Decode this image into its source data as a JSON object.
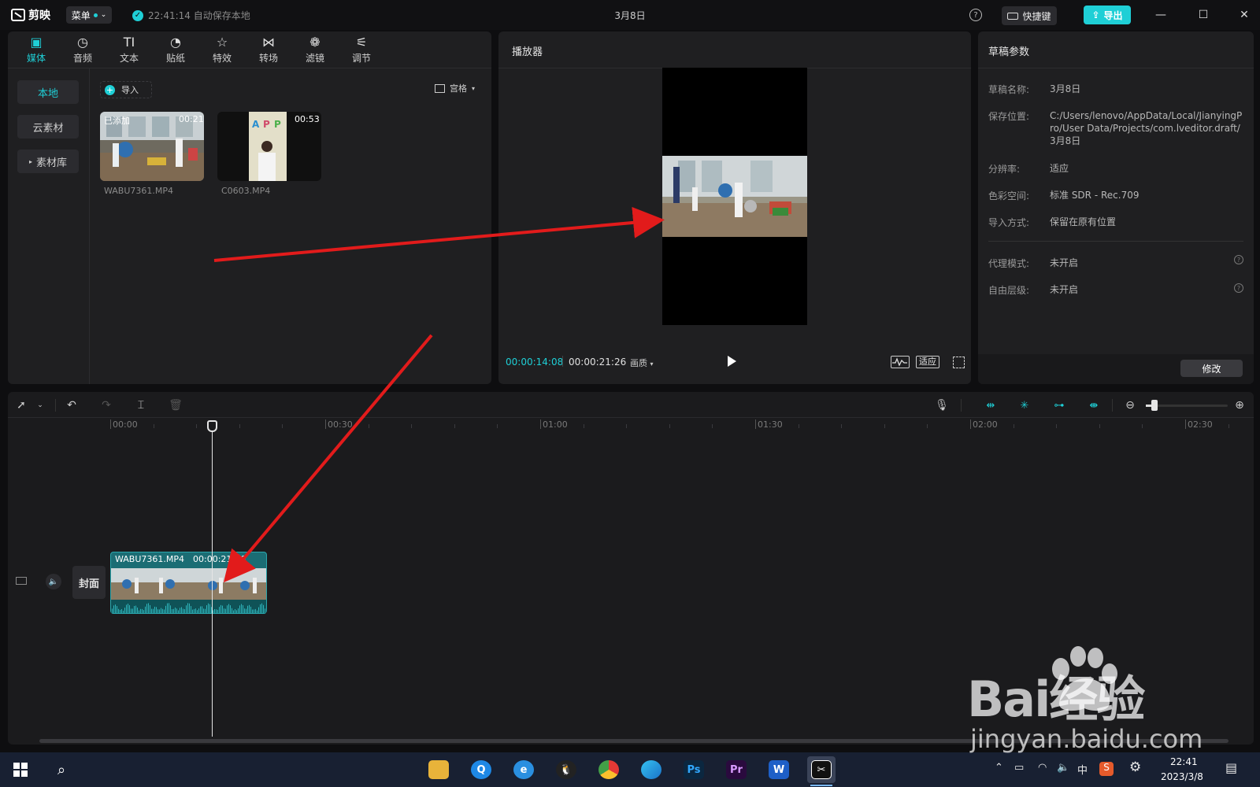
{
  "titlebar": {
    "app_name": "剪映",
    "menu_label": "菜单",
    "save_status": "22:41:14 自动保存本地",
    "project_title": "3月8日",
    "help_label": "?",
    "shortcut_label": "快捷键",
    "export_label": "导出",
    "minimize": "—",
    "maximize": "☐",
    "close": "✕",
    "accent_color": "#1fcfd6"
  },
  "media_tabs": [
    {
      "label": "媒体",
      "icon": "media-icon"
    },
    {
      "label": "音频",
      "icon": "audio-icon"
    },
    {
      "label": "文本",
      "icon": "text-icon"
    },
    {
      "label": "贴纸",
      "icon": "sticker-icon"
    },
    {
      "label": "特效",
      "icon": "effects-icon"
    },
    {
      "label": "转场",
      "icon": "transition-icon"
    },
    {
      "label": "滤镜",
      "icon": "filter-icon"
    },
    {
      "label": "调节",
      "icon": "adjust-icon"
    }
  ],
  "media_sidebar": {
    "local": "本地",
    "cloud": "云素材",
    "library": "素材库"
  },
  "media_toolbar": {
    "import_label": "导入",
    "view_label": "宫格"
  },
  "media_items": [
    {
      "name": "WABU7361.MP4",
      "badge": "已添加",
      "duration": "00:21"
    },
    {
      "name": "C0603.MP4",
      "duration": "00:53"
    }
  ],
  "player": {
    "title": "播放器",
    "current_time": "00:00:14:08",
    "total_time": "00:00:21:26",
    "quality_label": "画质",
    "fit_label": "适应"
  },
  "draft": {
    "title": "草稿参数",
    "name_key": "草稿名称:",
    "name_val": "3月8日",
    "path_key": "保存位置:",
    "path_val": "C:/Users/lenovo/AppData/Local/JianyingPro/User Data/Projects/com.lveditor.draft/3月8日",
    "res_key": "分辨率:",
    "res_val": "适应",
    "color_key": "色彩空间:",
    "color_val": "标准 SDR - Rec.709",
    "import_key": "导入方式:",
    "import_val": "保留在原有位置",
    "proxy_key": "代理模式:",
    "proxy_val": "未开启",
    "layer_key": "自由层级:",
    "layer_val": "未开启",
    "modify_label": "修改"
  },
  "timeline": {
    "ruler": [
      "00:00",
      "00:30",
      "01:00",
      "01:30",
      "02:00",
      "02:30"
    ],
    "cover_label": "封面",
    "clip_name": "WABU7361.MP4",
    "clip_duration": "00:00:21:26"
  },
  "taskbar": {
    "tray_lang": "中",
    "clock_time": "22:41",
    "clock_date": "2023/3/8"
  },
  "watermark": {
    "brand": "Bai经验",
    "url": "jingyan.baidu.com"
  }
}
